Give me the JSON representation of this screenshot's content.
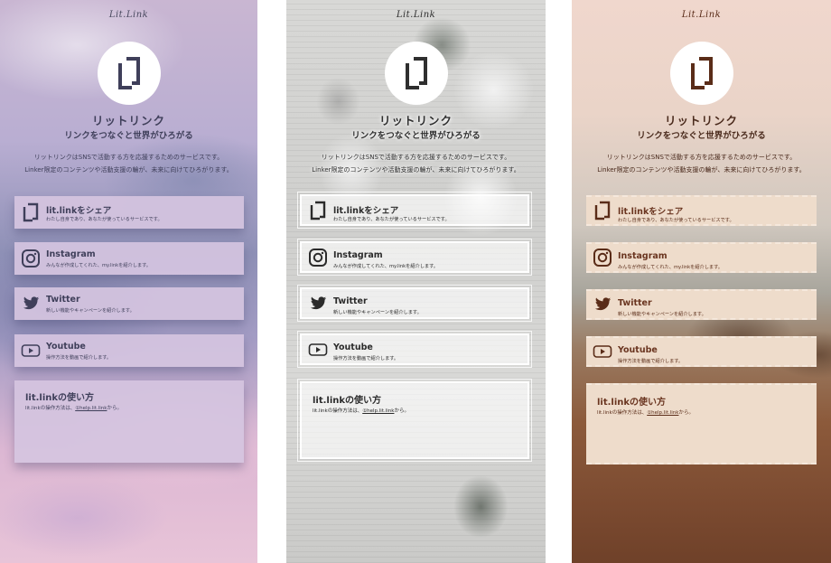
{
  "brand": "Lit.Link",
  "title": "リットリンク",
  "subtitle": "リンクをつなぐと世界がひろがる",
  "description_line1": "リットリンクはSNSで活動する方を応援するためのサービスです。",
  "description_line2": "Linker限定のコンテンツや活動支援の輪が、未来に向けてひろがります。",
  "links": [
    {
      "icon": "litlink-icon",
      "title": "lit.linkをシェア",
      "sub": "わたし自身であり、あなたが使っているサービスです。"
    },
    {
      "icon": "instagram-icon",
      "title": "Instagram",
      "sub": "みんなが作成してくれた、my.linkを紹介します。"
    },
    {
      "icon": "twitter-icon",
      "title": "Twitter",
      "sub": "新しい機能やキャンペーンを紹介します。"
    },
    {
      "icon": "youtube-icon",
      "title": "Youtube",
      "sub": "操作方法を動画で紹介します。"
    }
  ],
  "info": {
    "title": "lit.linkの使い方",
    "text_prefix": "lit.linkの操作方法は、",
    "link_text": "①help.lit.link",
    "text_suffix": "から。"
  },
  "themes": [
    {
      "name": "sky",
      "accent": "#3f3f5a",
      "card": "#d5c4e0"
    },
    {
      "name": "newspaper-roses",
      "accent": "#2f2f2f",
      "card": "#ffffff"
    },
    {
      "name": "field",
      "accent": "#5a2c18",
      "card": "#eedccb"
    }
  ]
}
